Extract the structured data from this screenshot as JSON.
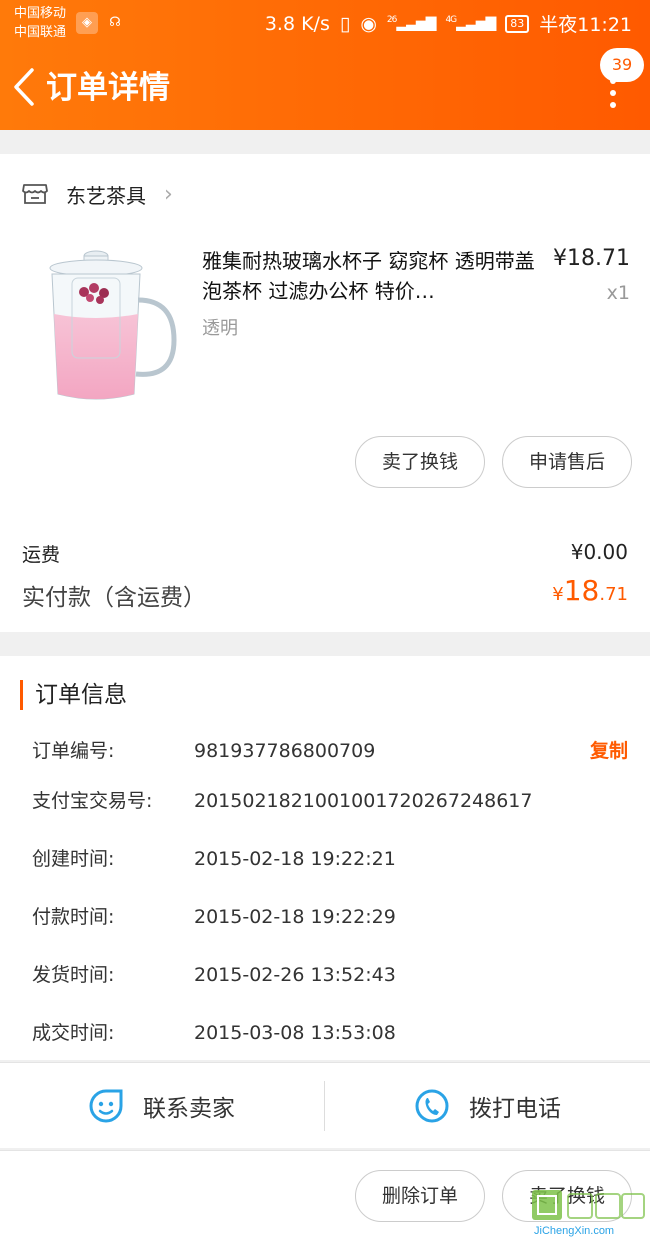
{
  "status_bar": {
    "carrier_1": "中国移动",
    "carrier_2": "中国联通",
    "speed": "3.8 K/s",
    "net_1": "26",
    "net_2": "4G",
    "battery": "83",
    "time": "半夜11:21"
  },
  "header": {
    "title": "订单详情",
    "badge_count": "39"
  },
  "store": {
    "name": "东艺茶具"
  },
  "product": {
    "title": "雅集耐热玻璃水杯子 窈窕杯 透明带盖泡茶杯 过滤办公杯 特价…",
    "price": "¥18.71",
    "qty": "x1",
    "sku": "透明"
  },
  "item_actions": {
    "sell_label": "卖了换钱",
    "aftersale_label": "申请售后"
  },
  "summary": {
    "shipping_label": "运费",
    "shipping_value": "¥0.00",
    "total_label": "实付款（含运费）",
    "total_currency": "¥",
    "total_int": "18",
    "total_dec": ".71"
  },
  "order_info": {
    "title": "订单信息",
    "copy_label": "复制",
    "rows": [
      {
        "key": "订单编号:",
        "value": "981937786800709"
      },
      {
        "key": "支付宝交易号:",
        "value": "2015021821001001720267248617"
      },
      {
        "key": "创建时间:",
        "value": "2015-02-18 19:22:21"
      },
      {
        "key": "付款时间:",
        "value": "2015-02-18 19:22:29"
      },
      {
        "key": "发货时间:",
        "value": "2015-02-26 13:52:43"
      },
      {
        "key": "成交时间:",
        "value": "2015-03-08 13:53:08"
      }
    ]
  },
  "contact": {
    "seller_label": "联系卖家",
    "call_label": "拨打电话"
  },
  "bottom_actions": {
    "delete_label": "删除订单",
    "sell_label": "卖了换钱"
  },
  "watermark": {
    "text": "JiChengXin.com"
  },
  "colors": {
    "accent": "#ff5a00",
    "header_start": "#ff7a0a",
    "link_blue": "#2aa3e6"
  }
}
